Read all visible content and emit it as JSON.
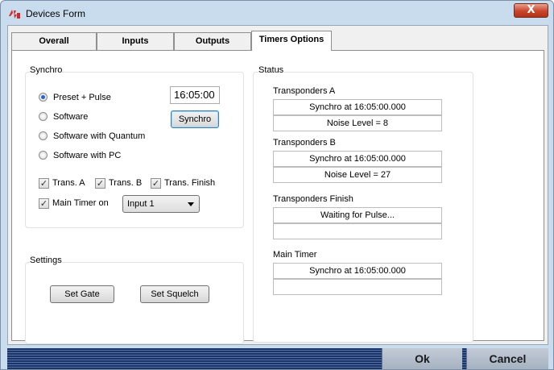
{
  "window": {
    "title": "Devices Form",
    "close_label": "X"
  },
  "tabs": [
    {
      "label": "Overall"
    },
    {
      "label": "Inputs"
    },
    {
      "label": "Outputs"
    },
    {
      "label": "Timers Options",
      "active": true
    }
  ],
  "synchro": {
    "group_label": "Synchro",
    "options": [
      {
        "label": "Preset + Pulse",
        "checked": true
      },
      {
        "label": "Software",
        "checked": false
      },
      {
        "label": "Software with Quantum",
        "checked": false
      },
      {
        "label": "Software with PC",
        "checked": false
      }
    ],
    "time_value": "16:05:00",
    "synchro_button": "Synchro",
    "checks": [
      {
        "label": "Trans. A",
        "checked": true
      },
      {
        "label": "Trans. B",
        "checked": true
      },
      {
        "label": "Trans. Finish",
        "checked": true
      }
    ],
    "main_timer": {
      "label": "Main Timer on",
      "checked": true,
      "selected": "Input 1"
    }
  },
  "settings": {
    "group_label": "Settings",
    "set_gate": "Set Gate",
    "set_squelch": "Set Squelch"
  },
  "status": {
    "group_label": "Status",
    "transponders_a": {
      "title": "Transponders A",
      "line1": "Synchro at 16:05:00.000",
      "line2": "Noise Level = 8"
    },
    "transponders_b": {
      "title": "Transponders B",
      "line1": "Synchro at 16:05:00.000",
      "line2": "Noise Level = 27"
    },
    "transponders_finish": {
      "title": "Transponders Finish",
      "line1": "Waiting for Pulse...",
      "line2": ""
    },
    "main_timer": {
      "title": "Main Timer",
      "line1": "Synchro at 16:05:00.000",
      "line2": ""
    }
  },
  "footer": {
    "ok": "Ok",
    "cancel": "Cancel"
  },
  "colors": {
    "close_red": "#c8452b",
    "radio_dot": "#2a66c4",
    "footer_blue": "#1c3466",
    "app_icon_red": "#d22a2a"
  },
  "icons": {
    "app": "devices-app-icon",
    "dropdown": "chevron-down-icon",
    "close": "close-icon"
  }
}
